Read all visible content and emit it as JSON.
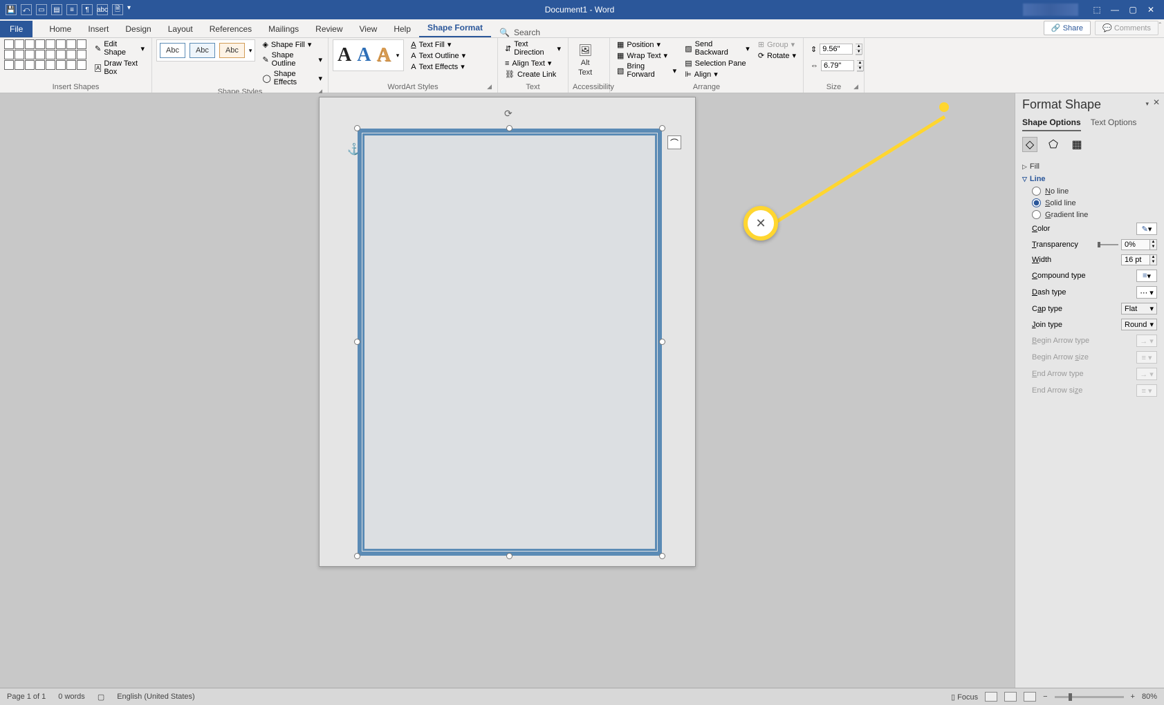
{
  "titlebar": {
    "doc": "Document1 - Word"
  },
  "tabs": {
    "file": "File",
    "home": "Home",
    "insert": "Insert",
    "design": "Design",
    "layout": "Layout",
    "references": "References",
    "mailings": "Mailings",
    "review": "Review",
    "view": "View",
    "help": "Help",
    "shape_format": "Shape Format",
    "search": "Search",
    "share": "Share",
    "comments": "Comments"
  },
  "ribbon": {
    "insert_shapes": {
      "label": "Insert Shapes",
      "edit_shape": "Edit Shape",
      "draw_textbox": "Draw Text Box"
    },
    "shape_styles": {
      "label": "Shape Styles",
      "abc": "Abc",
      "fill": "Shape Fill",
      "outline": "Shape Outline",
      "effects": "Shape Effects"
    },
    "wordart": {
      "label": "WordArt Styles",
      "glyph": "A",
      "fill": "Text Fill",
      "outline": "Text Outline",
      "effects": "Text Effects"
    },
    "text": {
      "label": "Text",
      "direction": "Text Direction",
      "align": "Align Text",
      "link": "Create Link"
    },
    "accessibility": {
      "label": "Accessibility",
      "alt1": "Alt",
      "alt2": "Text"
    },
    "arrange": {
      "label": "Arrange",
      "position": "Position",
      "wrap": "Wrap Text",
      "forward": "Bring Forward",
      "backward": "Send Backward",
      "selection": "Selection Pane",
      "align": "Align",
      "group": "Group",
      "rotate": "Rotate"
    },
    "size": {
      "label": "Size",
      "height": "9.56\"",
      "width": "6.79\""
    }
  },
  "pane": {
    "title": "Format Shape",
    "tab_shape": "Shape Options",
    "tab_text": "Text Options",
    "fill": "Fill",
    "line": "Line",
    "no_line": "No line",
    "solid_line": "Solid line",
    "gradient_line": "Gradient line",
    "color": "Color",
    "transparency": "Transparency",
    "transparency_val": "0%",
    "width": "Width",
    "width_val": "16 pt",
    "compound": "Compound type",
    "dash": "Dash type",
    "cap": "Cap type",
    "cap_val": "Flat",
    "join": "Join type",
    "join_val": "Round",
    "begin_type": "Begin Arrow type",
    "begin_size": "Begin Arrow size",
    "end_type": "End Arrow type",
    "end_size": "End Arrow size"
  },
  "status": {
    "page": "Page 1 of 1",
    "words": "0 words",
    "lang": "English (United States)",
    "focus": "Focus",
    "zoom": "80%"
  }
}
